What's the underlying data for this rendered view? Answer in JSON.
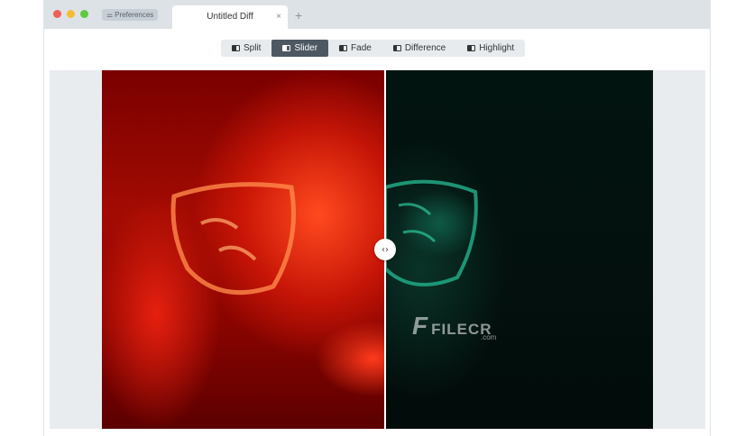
{
  "window": {
    "preferences_label": "Preferences",
    "tab_title": "Untitled Diff",
    "tab_close": "×",
    "new_tab": "+"
  },
  "modes": [
    {
      "label": "Split",
      "active": false
    },
    {
      "label": "Slider",
      "active": true
    },
    {
      "label": "Fade",
      "active": false
    },
    {
      "label": "Difference",
      "active": false
    },
    {
      "label": "Highlight",
      "active": false
    }
  ],
  "slider": {
    "position_fraction": 0.51,
    "handle_glyph": "‹›"
  },
  "watermark": {
    "mark": "F",
    "text": "FILECR",
    "sub": ".com"
  },
  "colors": {
    "active_mode": "#4d5862",
    "left_image_tint": "#d41a0a",
    "right_image_tint": "#0f5a45"
  }
}
